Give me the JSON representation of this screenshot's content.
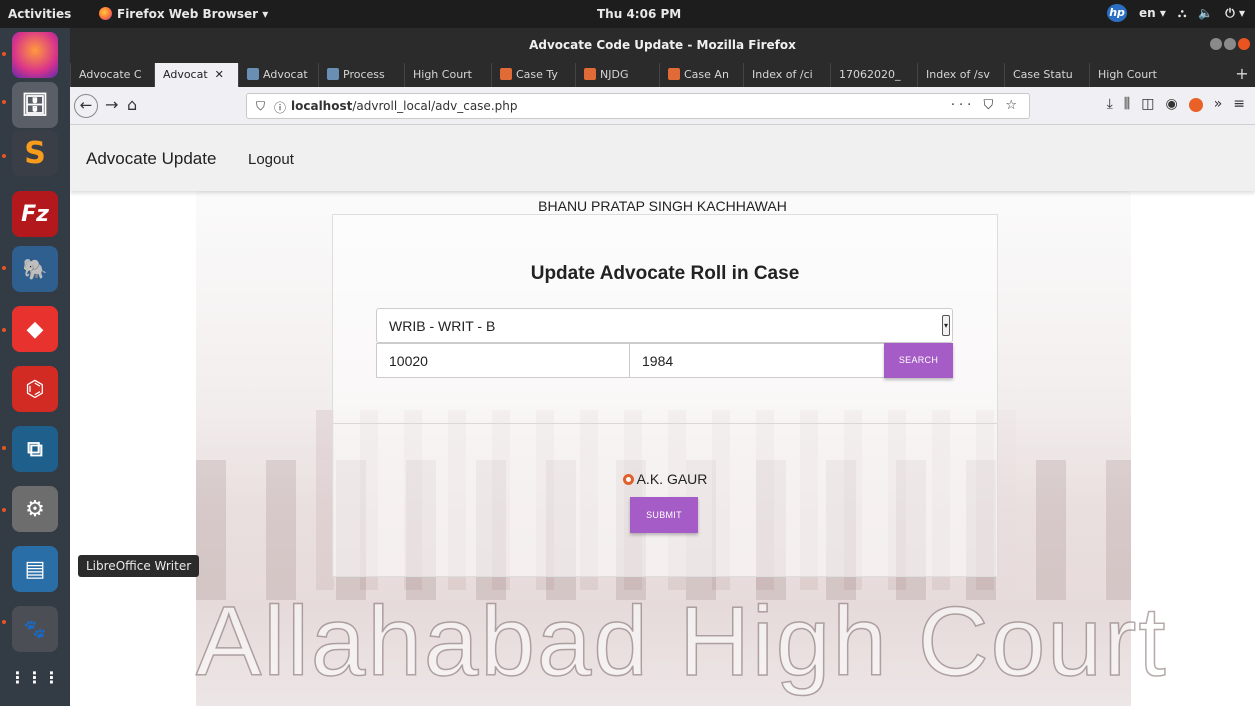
{
  "system": {
    "activities": "Activities",
    "app_menu": "Firefox Web Browser ▾",
    "clock": "Thu  4:06 PM",
    "lang": "en ▾",
    "tray_icons": [
      "network-icon",
      "volume-icon",
      "power-icon"
    ]
  },
  "browser": {
    "window_title": "Advocate Code Update - Mozilla Firefox",
    "tabs": [
      {
        "label": "Advocate C",
        "active": false
      },
      {
        "label": "Advocat",
        "active": true
      },
      {
        "label": "Advocat",
        "active": false
      },
      {
        "label": "Process",
        "active": false
      },
      {
        "label": "High Court",
        "active": false
      },
      {
        "label": "Case Ty",
        "active": false
      },
      {
        "label": "NJDG",
        "active": false
      },
      {
        "label": "Case An",
        "active": false
      },
      {
        "label": "Index of /ci",
        "active": false
      },
      {
        "label": "17062020_",
        "active": false
      },
      {
        "label": "Index of /sv",
        "active": false
      },
      {
        "label": "Case Statu",
        "active": false
      },
      {
        "label": "High Court",
        "active": false
      }
    ],
    "url_host": "localhost",
    "url_path": "/advroll_local/adv_case.php"
  },
  "dock": {
    "tooltip": "LibreOffice Writer"
  },
  "app": {
    "brand": "Advocate Update",
    "logout": "Logout",
    "advocate_name": "BHANU PRATAP SINGH KACHHAWAH",
    "heading": "Update Advocate Roll in Case",
    "case_type_selected": "WRIB - WRIT - B",
    "case_no": "10020",
    "case_year": "1984",
    "search_label": "SEARCH",
    "radio_option": "A.K. GAUR",
    "submit_label": "SUBMIT",
    "watermark": "Allahabad High Court",
    "accent_color": "#a55cc6"
  }
}
